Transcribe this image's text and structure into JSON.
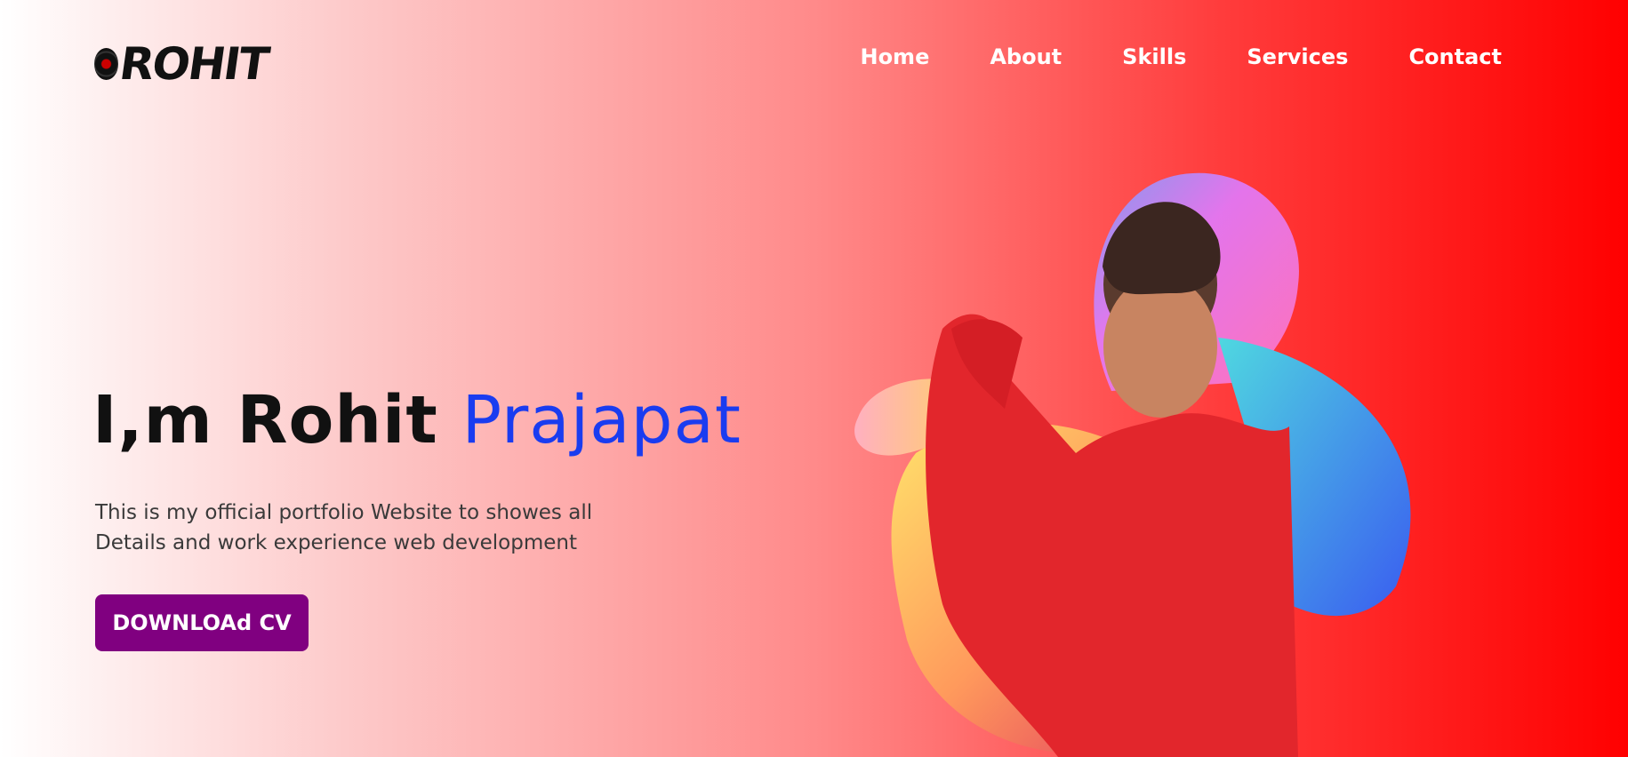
{
  "header": {
    "logo_text": "ROHIT",
    "nav": [
      "Home",
      "About",
      "Skills",
      "Services",
      "Contact"
    ]
  },
  "hero": {
    "title_main": "I,m Rohit ",
    "title_accent": "Prajapat",
    "description": "This is my official portfolio Website to showes all Details and work experience web development",
    "button_label": "DOWNLOAd CV"
  },
  "colors": {
    "accent_blue": "#1a3cf0",
    "button_purple": "#800080",
    "brand_red": "#ff0000"
  }
}
